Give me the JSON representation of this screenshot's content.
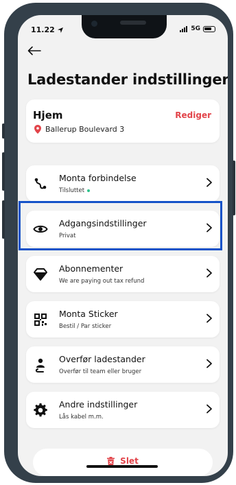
{
  "status": {
    "time": "11.22",
    "network": "5G"
  },
  "header": {
    "title": "Ladestander indstillinger"
  },
  "home": {
    "name": "Hjem",
    "edit_label": "Rediger",
    "address": "Ballerup Boulevard 3"
  },
  "items": [
    {
      "label": "Monta forbindelse",
      "sub": "Tilsluttet",
      "icon": "connection-icon"
    },
    {
      "label": "Adgangsindstillinger",
      "sub": "Privat",
      "icon": "eye-icon"
    },
    {
      "label": "Abonnementer",
      "sub": "We are paying out tax refund",
      "icon": "diamond-icon"
    },
    {
      "label": "Monta Sticker",
      "sub": "Bestil / Par sticker",
      "icon": "qr-code-icon"
    },
    {
      "label": "Overfør ladestander",
      "sub": "Overfør til team eller bruger",
      "icon": "user-transfer-icon"
    },
    {
      "label": "Andre indstillinger",
      "sub": "Lås kabel m.m.",
      "icon": "gear-icon"
    }
  ],
  "delete": {
    "label": "Slet"
  },
  "colors": {
    "accent_red": "#e2444a",
    "connected_green": "#2ec28c",
    "highlight_blue": "#1452c8"
  }
}
